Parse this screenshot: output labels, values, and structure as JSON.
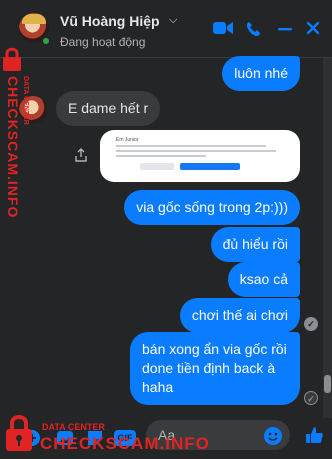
{
  "header": {
    "contact_name": "Vũ Hoàng Hiệp",
    "status": "Đang hoạt động"
  },
  "messages": [
    {
      "side": "out",
      "text": "luôn nhé"
    },
    {
      "side": "in",
      "text": "E dame hết r"
    },
    {
      "side": "out",
      "text": "via gốc sống trong 2p:)))"
    },
    {
      "side": "out",
      "text": "đủ hiểu rồi"
    },
    {
      "side": "out",
      "text": "ksao cả"
    },
    {
      "side": "out",
      "text": "chơi thế ai chơi"
    },
    {
      "side": "out",
      "text": "bán xong ẩn via gốc rồi done tiền định back à haha"
    }
  ],
  "screenshot_preview": {
    "title": "Em Junior"
  },
  "composer": {
    "placeholder": "Aa",
    "gif_label": "GIF"
  },
  "watermark": {
    "main": "CHECKSCAM.INFO",
    "sub": "DATA CENTER"
  },
  "colors": {
    "accent": "#0a7cff",
    "background": "#242526",
    "incoming_bubble": "#3a3b3c",
    "watermark": "#e02424",
    "online": "#31a24c"
  }
}
